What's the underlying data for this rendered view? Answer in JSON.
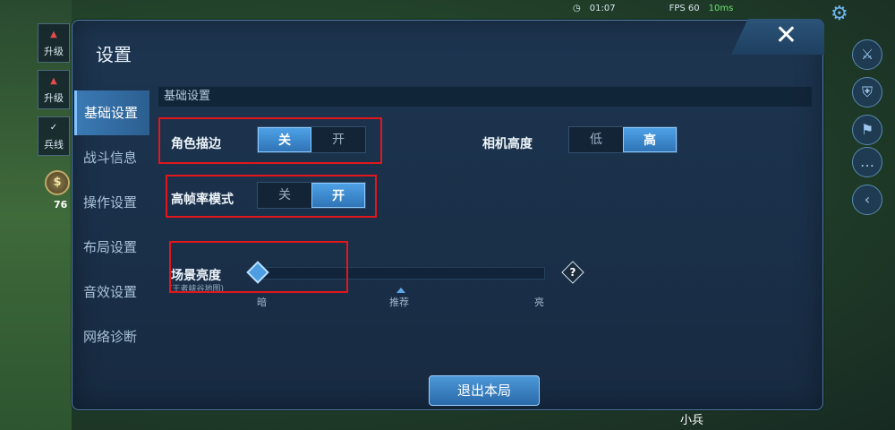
{
  "hud": {
    "left_buttons": [
      {
        "label": "升级"
      },
      {
        "label": "升级"
      },
      {
        "label": "兵线"
      }
    ],
    "coin_count": "76",
    "clock": "01:07",
    "fps": "FPS 60",
    "ping": "10ms",
    "minimap_unit_label": "小兵"
  },
  "panel": {
    "title": "设置",
    "close_label": "✕"
  },
  "sidebar": {
    "items": [
      {
        "label": "基础设置",
        "active": true
      },
      {
        "label": "战斗信息",
        "active": false
      },
      {
        "label": "操作设置",
        "active": false
      },
      {
        "label": "布局设置",
        "active": false
      },
      {
        "label": "音效设置",
        "active": false
      },
      {
        "label": "网络诊断",
        "active": false
      }
    ]
  },
  "content": {
    "section_header": "基础设置",
    "outline": {
      "label": "角色描边",
      "options": [
        "关",
        "开"
      ],
      "selected": "关"
    },
    "camera_height": {
      "label": "相机高度",
      "options": [
        "低",
        "高"
      ],
      "selected": "高"
    },
    "high_fps": {
      "label": "高帧率模式",
      "options": [
        "关",
        "开"
      ],
      "selected": "开"
    },
    "brightness": {
      "label": "场景亮度",
      "sublabel": "(王者峡谷地图)",
      "ticks": [
        "暗",
        "推荐",
        "亮"
      ],
      "value": 0.0,
      "help": "?"
    },
    "exit_button": "退出本局"
  },
  "colors": {
    "accent": "#3f8fd6",
    "highlight_box": "#e2161b",
    "panel_bg": "#1a2f48"
  }
}
